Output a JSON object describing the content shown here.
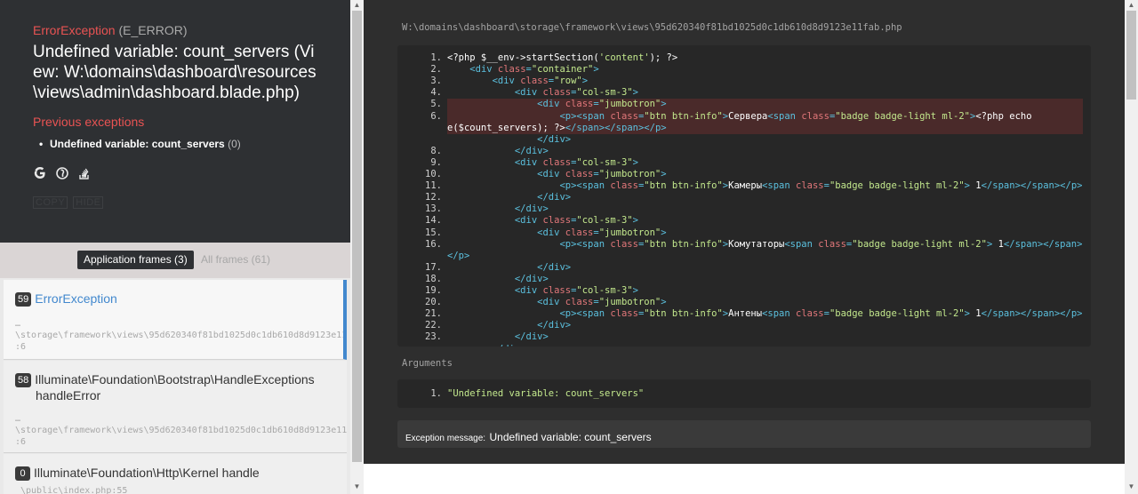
{
  "header": {
    "exception_class": "ErrorException",
    "exception_level": "(E_ERROR)",
    "message": "Undefined variable: count_servers (View: W:\\domains\\dashboard\\resources\\views\\admin\\dashboard.blade.php)",
    "previous_title": "Previous exceptions",
    "previous": [
      {
        "text": "Undefined variable: count_servers",
        "count": "(0)"
      }
    ],
    "icons": [
      "google-icon",
      "duckduckgo-icon",
      "stackoverflow-icon"
    ],
    "copy_label": "COPY",
    "hide_label": "HIDE"
  },
  "frames_tabs": {
    "application": "Application frames (3)",
    "all": "All frames (61)"
  },
  "frames": [
    {
      "num": "59",
      "class": "ErrorException",
      "method": "",
      "dots": "…",
      "path": "\\storage\\framework\\views\\95d620340f81bd1025d0c1db610d8d9123e11fab.php",
      "line": ":6"
    },
    {
      "num": "58",
      "class": "Illuminate\\Foundation\\Bootstrap\\HandleExceptions",
      "method": "handleError",
      "dots": "…",
      "path": "\\storage\\framework\\views\\95d620340f81bd1025d0c1db610d8d9123e11fab.php",
      "line": ":6"
    },
    {
      "num": "0",
      "class": "Illuminate\\Foundation\\Http\\Kernel handle",
      "method": "",
      "dots": "",
      "path": "\\public\\index.php:55",
      "line": ""
    }
  ],
  "code": {
    "file_path": "W:\\domains\\dashboard\\storage\\framework\\views\\95d620340f81bd1025d0c1db610d8d9123e11fab.php",
    "highlight_lines": [
      5,
      6
    ],
    "lines": [
      {
        "n": "1.",
        "src": "<?php $__env->startSection('content'); ?>"
      },
      {
        "n": "2.",
        "src": "    <div class=\"container\">"
      },
      {
        "n": "3.",
        "src": "        <div class=\"row\">"
      },
      {
        "n": "4.",
        "src": "            <div class=\"col-sm-3\">"
      },
      {
        "n": "5.",
        "src": "                <div class=\"jumbotron\">"
      },
      {
        "n": "6.",
        "src": "                    <p><span class=\"btn btn-info\">Сервера<span class=\"badge badge-light ml-2\"><?php echo"
      },
      {
        "n": "",
        "src": "e($count_servers); ?></span></span></p>"
      },
      {
        "n": "",
        "src": "                </div>"
      },
      {
        "n": "8.",
        "src": "            </div>"
      },
      {
        "n": "9.",
        "src": "            <div class=\"col-sm-3\">"
      },
      {
        "n": "10.",
        "src": "                <div class=\"jumbotron\">"
      },
      {
        "n": "11.",
        "src": "                    <p><span class=\"btn btn-info\">Камеры<span class=\"badge badge-light ml-2\"> 1</span></span></p>"
      },
      {
        "n": "12.",
        "src": "                </div>"
      },
      {
        "n": "13.",
        "src": "            </div>"
      },
      {
        "n": "14.",
        "src": "            <div class=\"col-sm-3\">"
      },
      {
        "n": "15.",
        "src": "                <div class=\"jumbotron\">"
      },
      {
        "n": "16.",
        "src": "                    <p><span class=\"btn btn-info\">Комутаторы<span class=\"badge badge-light ml-2\"> 1</span></span>"
      },
      {
        "n": "",
        "src": "</p>"
      },
      {
        "n": "17.",
        "src": "                </div>"
      },
      {
        "n": "18.",
        "src": "            </div>"
      },
      {
        "n": "19.",
        "src": "            <div class=\"col-sm-3\">"
      },
      {
        "n": "20.",
        "src": "                <div class=\"jumbotron\">"
      },
      {
        "n": "21.",
        "src": "                    <p><span class=\"btn btn-info\">Антены<span class=\"badge badge-light ml-2\"> 1</span></span></p>"
      },
      {
        "n": "22.",
        "src": "                </div>"
      },
      {
        "n": "23.",
        "src": "            </div>"
      },
      {
        "n": "",
        "src": "        </div>"
      }
    ]
  },
  "arguments": {
    "title": "Arguments",
    "items": [
      {
        "n": "1.",
        "value": "\"Undefined variable: count_servers\""
      }
    ]
  },
  "exception_message": {
    "label": "Exception message:",
    "text": "Undefined variable: count_servers"
  },
  "colors": {
    "error_red": "#e95353",
    "accent_blue": "#4288ce",
    "panel_dark": "#2e3033",
    "code_bg": "#272727"
  }
}
